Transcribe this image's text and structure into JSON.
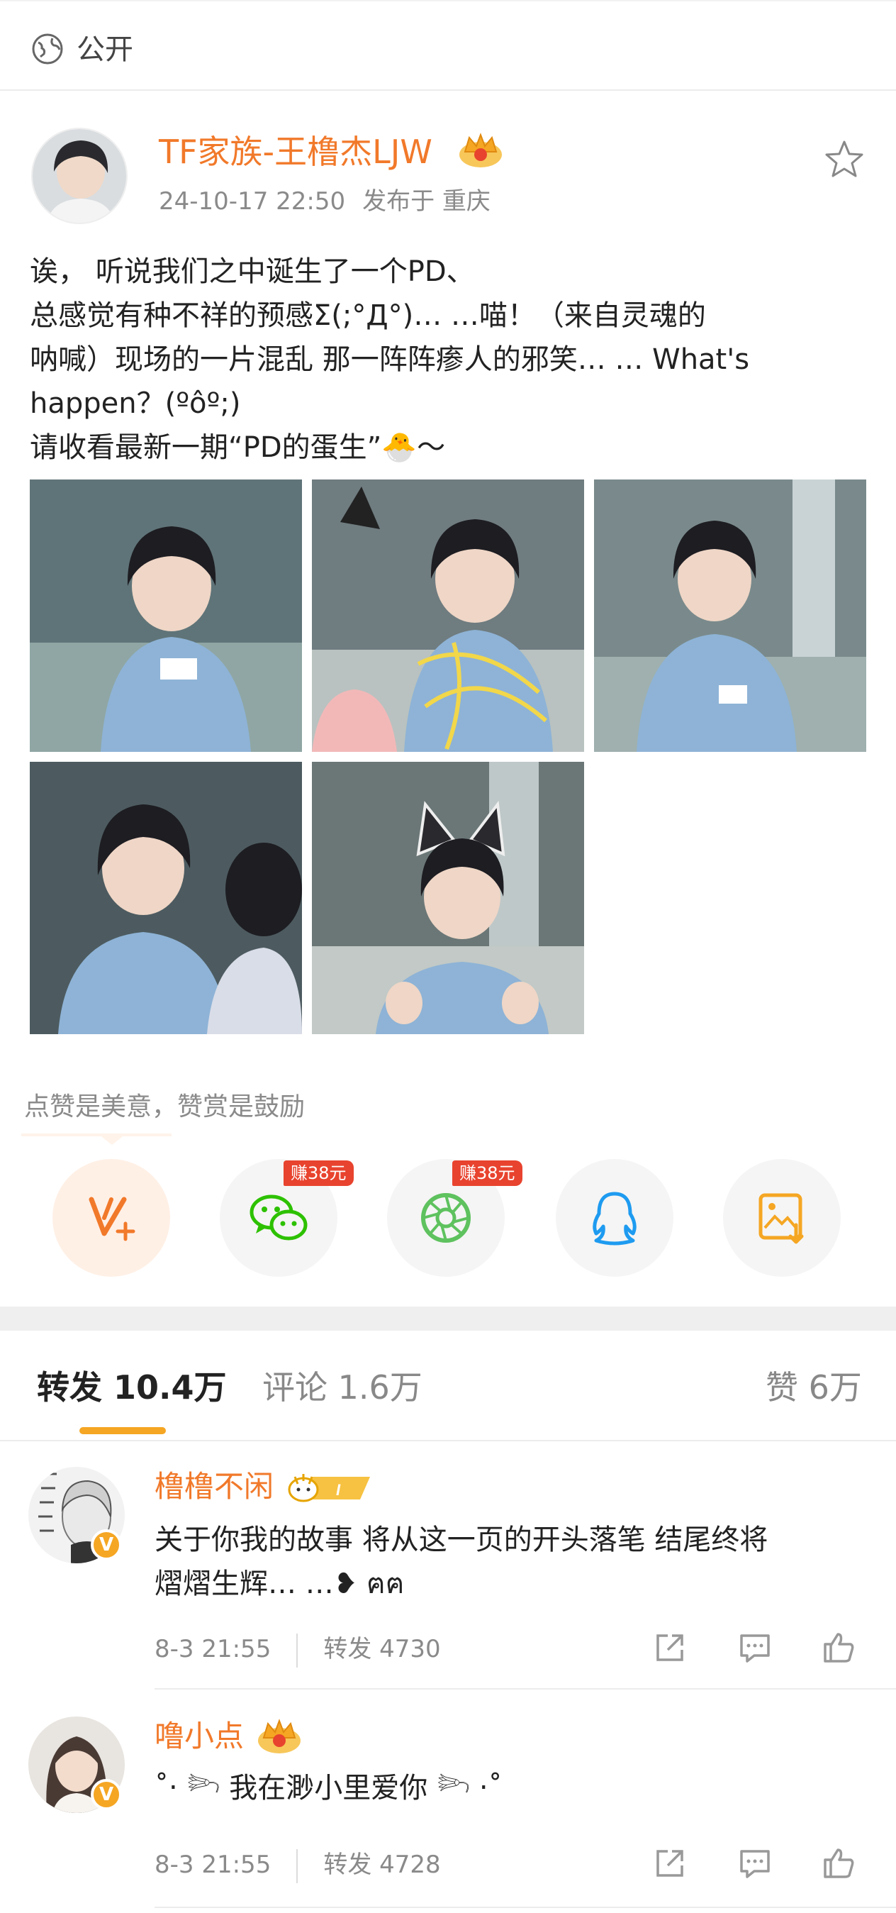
{
  "header": {
    "visibility": "公开",
    "icon": "globe-icon"
  },
  "post": {
    "author": "TF家族-王橹杰LJW",
    "time": "24-10-17 22:50",
    "location": "发布于 重庆",
    "text_lines": [
      "诶， 听说我们之中诞生了一个PD、",
      "总感觉有种不祥的预感Σ(;°Д°)… …喵！（来自灵魂的",
      "呐喊）现场的一片混乱 那一阵阵瘆人的邪笑… … What's",
      "happen？(ºôº;)",
      "请收看最新一期“PD的蛋生”🐣～"
    ],
    "photo_count": 5
  },
  "reward": {
    "tip": "点赞是美意，赞赏是鼓励",
    "share_buttons": [
      {
        "name": "weibo-v-plus-icon",
        "badge": ""
      },
      {
        "name": "wechat-icon",
        "badge": "赚38元"
      },
      {
        "name": "moments-icon",
        "badge": "赚38元"
      },
      {
        "name": "qq-icon",
        "badge": ""
      },
      {
        "name": "save-image-icon",
        "badge": ""
      }
    ]
  },
  "tabs": {
    "repost_label": "转发",
    "repost_count": "10.4万",
    "comment_label": "评论",
    "comment_count": "1.6万",
    "like_label": "赞",
    "like_count": "6万"
  },
  "reposts": [
    {
      "user": "橹橹不闲",
      "text_lines": [
        "关于你我的故事 将从这一页的开头落笔 结尾终将",
        "熠熠生辉… …❥ ฅฅ"
      ],
      "time": "8-3 21:55",
      "repost": "转发 4730"
    },
    {
      "user": "噜小点",
      "text_lines": [
        "˚‧ 𓆸 我在渺小里爱你 𓆸 ‧˚"
      ],
      "time": "8-3 21:55",
      "repost": "转发 4728"
    }
  ],
  "colors": {
    "accent": "#f1792a",
    "tab_underline": "#f5a623",
    "earn_badge": "#e8432e",
    "wechat": "#2dc100",
    "moments": "#5ec25e",
    "qq": "#1e9bf0",
    "save": "#f5a623"
  }
}
